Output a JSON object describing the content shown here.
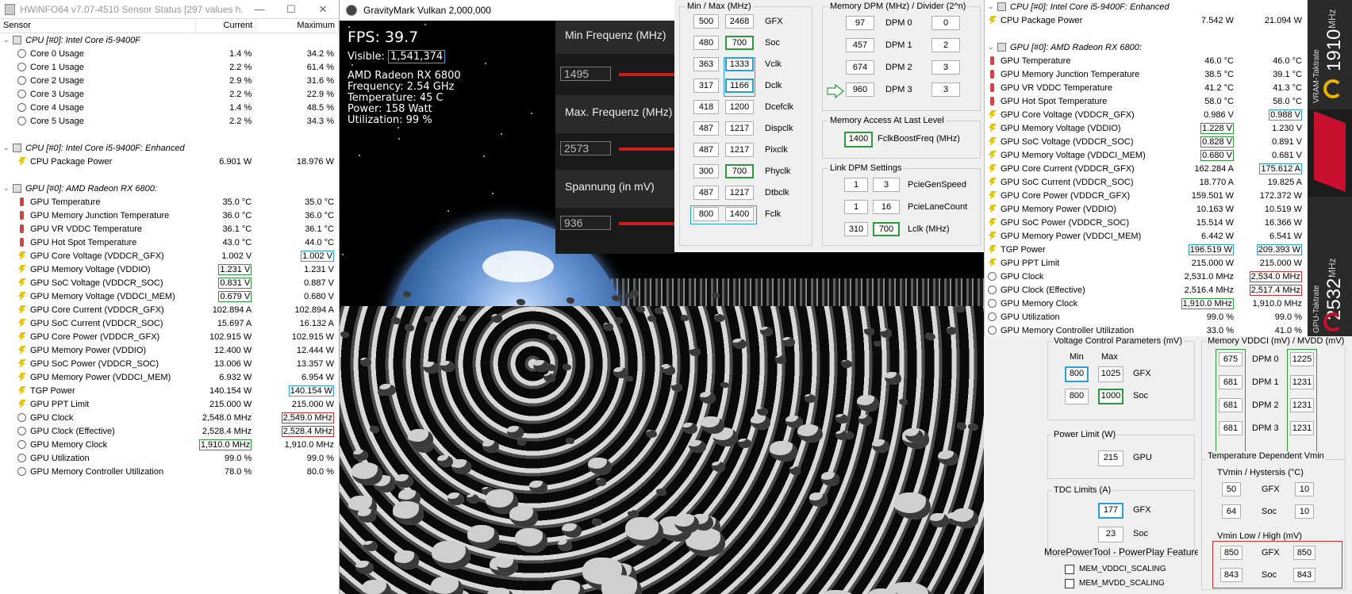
{
  "hwinfo": {
    "title": "HWiNFO64 v7.07-4510 Sensor Status [297 values h...",
    "window_buttons": [
      "—",
      "☐",
      "✕"
    ],
    "columns": [
      "Sensor",
      "Current",
      "Maximum"
    ],
    "rows": [
      {
        "type": "group",
        "label": "CPU [#0]: Intel Core i5-9400F",
        "current": "",
        "maximum": ""
      },
      {
        "type": "clock",
        "label": "Core 0 Usage",
        "current": "1.4 %",
        "maximum": "34.2 %"
      },
      {
        "type": "clock",
        "label": "Core 1 Usage",
        "current": "2.2 %",
        "maximum": "61.4 %"
      },
      {
        "type": "clock",
        "label": "Core 2 Usage",
        "current": "2.9 %",
        "maximum": "31.6 %"
      },
      {
        "type": "clock",
        "label": "Core 3 Usage",
        "current": "2.2 %",
        "maximum": "22.9 %"
      },
      {
        "type": "clock",
        "label": "Core 4 Usage",
        "current": "1.4 %",
        "maximum": "48.5 %"
      },
      {
        "type": "clock",
        "label": "Core 5 Usage",
        "current": "2.2 %",
        "maximum": "34.3 %"
      },
      {
        "type": "blank",
        "label": "",
        "current": "",
        "maximum": ""
      },
      {
        "type": "group",
        "label": "CPU [#0]: Intel Core i5-9400F: Enhanced",
        "current": "",
        "maximum": ""
      },
      {
        "type": "bolt",
        "label": "CPU Package Power",
        "current": "6.901 W",
        "maximum": "18.976 W"
      },
      {
        "type": "blank",
        "label": "",
        "current": "",
        "maximum": ""
      },
      {
        "type": "group",
        "label": "GPU [#0]: AMD Radeon RX 6800:",
        "current": "",
        "maximum": ""
      },
      {
        "type": "therm",
        "label": "GPU Temperature",
        "current": "35.0 °C",
        "maximum": "35.0 °C"
      },
      {
        "type": "therm",
        "label": "GPU Memory Junction Temperature",
        "current": "36.0 °C",
        "maximum": "36.0 °C"
      },
      {
        "type": "therm",
        "label": "GPU VR VDDC Temperature",
        "current": "36.1 °C",
        "maximum": "36.1 °C"
      },
      {
        "type": "therm",
        "label": "GPU Hot Spot Temperature",
        "current": "43.0 °C",
        "maximum": "44.0 °C"
      },
      {
        "type": "bolt",
        "label": "GPU Core Voltage (VDDCR_GFX)",
        "current": "1.002 V",
        "maximum": "1.002 V",
        "mbox": "b"
      },
      {
        "type": "bolt",
        "label": "GPU Memory Voltage (VDDIO)",
        "current": "1.231 V",
        "maximum": "1.231 V",
        "cbox": "g"
      },
      {
        "type": "bolt",
        "label": "GPU SoC Voltage (VDDCR_SOC)",
        "current": "0.831 V",
        "maximum": "0.887 V",
        "cbox": "g"
      },
      {
        "type": "bolt",
        "label": "GPU Memory Voltage (VDDCI_MEM)",
        "current": "0.679 V",
        "maximum": "0.680 V",
        "cbox": "g"
      },
      {
        "type": "bolt",
        "label": "GPU Core Current (VDDCR_GFX)",
        "current": "102.894 A",
        "maximum": "102.894 A"
      },
      {
        "type": "bolt",
        "label": "GPU SoC Current (VDDCR_SOC)",
        "current": "15.697 A",
        "maximum": "16.132 A"
      },
      {
        "type": "bolt",
        "label": "GPU Core Power (VDDCR_GFX)",
        "current": "102.915 W",
        "maximum": "102.915 W"
      },
      {
        "type": "bolt",
        "label": "GPU Memory Power (VDDIO)",
        "current": "12.400 W",
        "maximum": "12.444 W"
      },
      {
        "type": "bolt",
        "label": "GPU SoC Power (VDDCR_SOC)",
        "current": "13.006 W",
        "maximum": "13.357 W"
      },
      {
        "type": "bolt",
        "label": "GPU Memory Power (VDDCI_MEM)",
        "current": "6.932 W",
        "maximum": "6.954 W"
      },
      {
        "type": "bolt",
        "label": "TGP Power",
        "current": "140.154 W",
        "maximum": "140.154 W",
        "mbox": "b"
      },
      {
        "type": "bolt",
        "label": "GPU PPT Limit",
        "current": "215.000 W",
        "maximum": "215.000 W"
      },
      {
        "type": "clock",
        "label": "GPU Clock",
        "current": "2,548.0 MHz",
        "maximum": "2,549.0 MHz",
        "mbox": "r"
      },
      {
        "type": "clock",
        "label": "GPU Clock (Effective)",
        "current": "2,528.4 MHz",
        "maximum": "2,528.4 MHz",
        "mbox": "r"
      },
      {
        "type": "clock",
        "label": "GPU Memory Clock",
        "current": "1,910.0 MHz",
        "maximum": "1,910.0 MHz",
        "cbox": "g"
      },
      {
        "type": "clock",
        "label": "GPU Utilization",
        "current": "99.0 %",
        "maximum": "99.0 %"
      },
      {
        "type": "clock",
        "label": "GPU Memory Controller Utilization",
        "current": "78.0 %",
        "maximum": "80.0 %"
      }
    ]
  },
  "game": {
    "title": "GravityMark Vulkan 2,000,000",
    "fps": "FPS: 39.7",
    "visible_label": "Visible:",
    "visible_value": "1,541,374",
    "info": [
      "AMD Radeon RX 6800",
      "Frequency: 2.54 GHz",
      "Temperature: 45 C",
      "Power: 158 Watt",
      "Utilization: 99 %"
    ],
    "overlay": {
      "min_label": "Min Frequenz (MHz)",
      "min_value": "1495",
      "max_label": "Max. Frequenz (MHz)",
      "max_value": "2573",
      "volt_label": "Spannung (in mV)",
      "volt_value": "936"
    }
  },
  "clocks_panel": {
    "header": "Min / Max (MHz)",
    "rows": [
      {
        "min": "500",
        "max": "2468",
        "name": "GFX"
      },
      {
        "min": "480",
        "max": "700",
        "name": "Soc"
      },
      {
        "min": "363",
        "max": "1333",
        "name": "Vclk"
      },
      {
        "min": "317",
        "max": "1166",
        "name": "Dclk"
      },
      {
        "min": "418",
        "max": "1200",
        "name": "Dcefclk"
      },
      {
        "min": "487",
        "max": "1217",
        "name": "Dispclk"
      },
      {
        "min": "487",
        "max": "1217",
        "name": "Pixclk"
      },
      {
        "min": "300",
        "max": "700",
        "name": "Phyclk"
      },
      {
        "min": "487",
        "max": "1217",
        "name": "Dtbclk"
      },
      {
        "min": "800",
        "max": "1400",
        "name": "Fclk"
      }
    ]
  },
  "mem_dpm": {
    "header": "Memory DPM (MHz) / Divider (2^n)",
    "rows": [
      {
        "mhz": "97",
        "name": "DPM 0",
        "div": "0"
      },
      {
        "mhz": "457",
        "name": "DPM 1",
        "div": "2"
      },
      {
        "mhz": "674",
        "name": "DPM 2",
        "div": "3"
      },
      {
        "mhz": "960",
        "name": "DPM 3",
        "div": "3"
      }
    ],
    "access_header": "Memory Access At Last Level",
    "fclk_boost_value": "1400",
    "fclk_boost_label": "FclkBoostFreq (MHz)",
    "link_header": "Link DPM Settings",
    "link_rows": [
      {
        "a": "1",
        "b": "3",
        "name": "PcieGenSpeed"
      },
      {
        "a": "1",
        "b": "16",
        "name": "PcieLaneCount"
      },
      {
        "a": "310",
        "b": "700",
        "name": "Lclk (MHz)"
      }
    ]
  },
  "hwinfo2": {
    "rows": [
      {
        "type": "group",
        "label": "CPU [#0]: Intel Core i5-9400F: Enhanced",
        "current": "",
        "maximum": ""
      },
      {
        "type": "bolt",
        "label": "CPU Package Power",
        "current": "7.542 W",
        "maximum": "21.094 W"
      },
      {
        "type": "blank",
        "label": "",
        "current": "",
        "maximum": ""
      },
      {
        "type": "group",
        "label": "GPU [#0]: AMD Radeon RX 6800:",
        "current": "",
        "maximum": ""
      },
      {
        "type": "therm",
        "label": "GPU Temperature",
        "current": "46.0 °C",
        "maximum": "46.0 °C"
      },
      {
        "type": "therm",
        "label": "GPU Memory Junction Temperature",
        "current": "38.5 °C",
        "maximum": "39.1 °C"
      },
      {
        "type": "therm",
        "label": "GPU VR VDDC Temperature",
        "current": "41.2 °C",
        "maximum": "41.3 °C"
      },
      {
        "type": "therm",
        "label": "GPU Hot Spot Temperature",
        "current": "58.0 °C",
        "maximum": "58.0 °C"
      },
      {
        "type": "bolt",
        "label": "GPU Core Voltage (VDDCR_GFX)",
        "current": "0.986 V",
        "maximum": "0.988 V",
        "mbox": "b"
      },
      {
        "type": "bolt",
        "label": "GPU Memory Voltage (VDDIO)",
        "current": "1.228 V",
        "maximum": "1.230 V",
        "cbox": "g"
      },
      {
        "type": "bolt",
        "label": "GPU SoC Voltage (VDDCR_SOC)",
        "current": "0.828 V",
        "maximum": "0.891 V",
        "cbox": "g"
      },
      {
        "type": "bolt",
        "label": "GPU Memory Voltage (VDDCI_MEM)",
        "current": "0.680 V",
        "maximum": "0.681 V",
        "cbox": "g"
      },
      {
        "type": "bolt",
        "label": "GPU Core Current (VDDCR_GFX)",
        "current": "162.284 A",
        "maximum": "175.612 A",
        "mbox": "b"
      },
      {
        "type": "bolt",
        "label": "GPU SoC Current (VDDCR_SOC)",
        "current": "18.770 A",
        "maximum": "19.825 A"
      },
      {
        "type": "bolt",
        "label": "GPU Core Power (VDDCR_GFX)",
        "current": "159.501 W",
        "maximum": "172.372 W"
      },
      {
        "type": "bolt",
        "label": "GPU Memory Power (VDDIO)",
        "current": "10.163 W",
        "maximum": "10.519 W"
      },
      {
        "type": "bolt",
        "label": "GPU SoC Power (VDDCR_SOC)",
        "current": "15.514 W",
        "maximum": "16.366 W"
      },
      {
        "type": "bolt",
        "label": "GPU Memory Power (VDDCI_MEM)",
        "current": "6.442 W",
        "maximum": "6.541 W"
      },
      {
        "type": "bolt",
        "label": "TGP Power",
        "current": "196.519 W",
        "maximum": "209.393 W",
        "cbox": "b",
        "mbox": "b"
      },
      {
        "type": "bolt",
        "label": "GPU PPT Limit",
        "current": "215.000 W",
        "maximum": "215.000 W"
      },
      {
        "type": "clock",
        "label": "GPU Clock",
        "current": "2,531.0 MHz",
        "maximum": "2,534.0 MHz",
        "mbox": "r"
      },
      {
        "type": "clock",
        "label": "GPU Clock (Effective)",
        "current": "2,516.4 MHz",
        "maximum": "2,517.4 MHz",
        "mbox": "r"
      },
      {
        "type": "clock",
        "label": "GPU Memory Clock",
        "current": "1,910.0 MHz",
        "maximum": "1,910.0 MHz",
        "cbox": "g"
      },
      {
        "type": "clock",
        "label": "GPU Utilization",
        "current": "99.0 %",
        "maximum": "99.0 %"
      },
      {
        "type": "clock",
        "label": "GPU Memory Controller Utilization",
        "current": "33.0 %",
        "maximum": "41.0 %"
      }
    ]
  },
  "gadget": {
    "vram_label": "VRAM-Taktrate",
    "vram_value": "1910",
    "vram_unit": "MHz",
    "gpu_label": "GPU-Taktrate",
    "gpu_value": "2532",
    "gpu_unit": "MHz",
    "accent": "#c8102e"
  },
  "voltage_panel": {
    "header": "Voltage Control Parameters (mV)",
    "min_label": "Min",
    "max_label": "Max",
    "rows": [
      {
        "min": "800",
        "max": "1025",
        "name": "GFX"
      },
      {
        "min": "800",
        "max": "1000",
        "name": "Soc"
      }
    ],
    "power_header": "Power Limit (W)",
    "power_value": "215",
    "power_name": "GPU",
    "tdc_header": "TDC Limits (A)",
    "tdc_rows": [
      {
        "value": "177",
        "name": "GFX"
      },
      {
        "value": "23",
        "name": "Soc"
      }
    ],
    "features_header": "MorePowerTool - PowerPlay Feature",
    "features": [
      "MEM_VDDCI_SCALING",
      "MEM_MVDD_SCALING"
    ]
  },
  "mem_vddci": {
    "header": "Memory VDDCI (mV) / MVDD (mV)",
    "rows": [
      {
        "a": "675",
        "name": "DPM 0",
        "b": "1225"
      },
      {
        "a": "681",
        "name": "DPM 1",
        "b": "1231"
      },
      {
        "a": "681",
        "name": "DPM 2",
        "b": "1231"
      },
      {
        "a": "681",
        "name": "DPM 3",
        "b": "1231"
      }
    ],
    "temp_header": "Temperature Dependent Vmin",
    "tvmin_label": "TVmin / Hystersis (°C)",
    "tvmin_rows": [
      {
        "a": "50",
        "name": "GFX",
        "b": "10"
      },
      {
        "a": "64",
        "name": "Soc",
        "b": "10"
      }
    ],
    "vmin_label": "Vmin Low / High (mV)",
    "vmin_rows": [
      {
        "a": "850",
        "name": "GFX",
        "b": "850"
      },
      {
        "a": "843",
        "name": "Soc",
        "b": "843"
      }
    ]
  }
}
